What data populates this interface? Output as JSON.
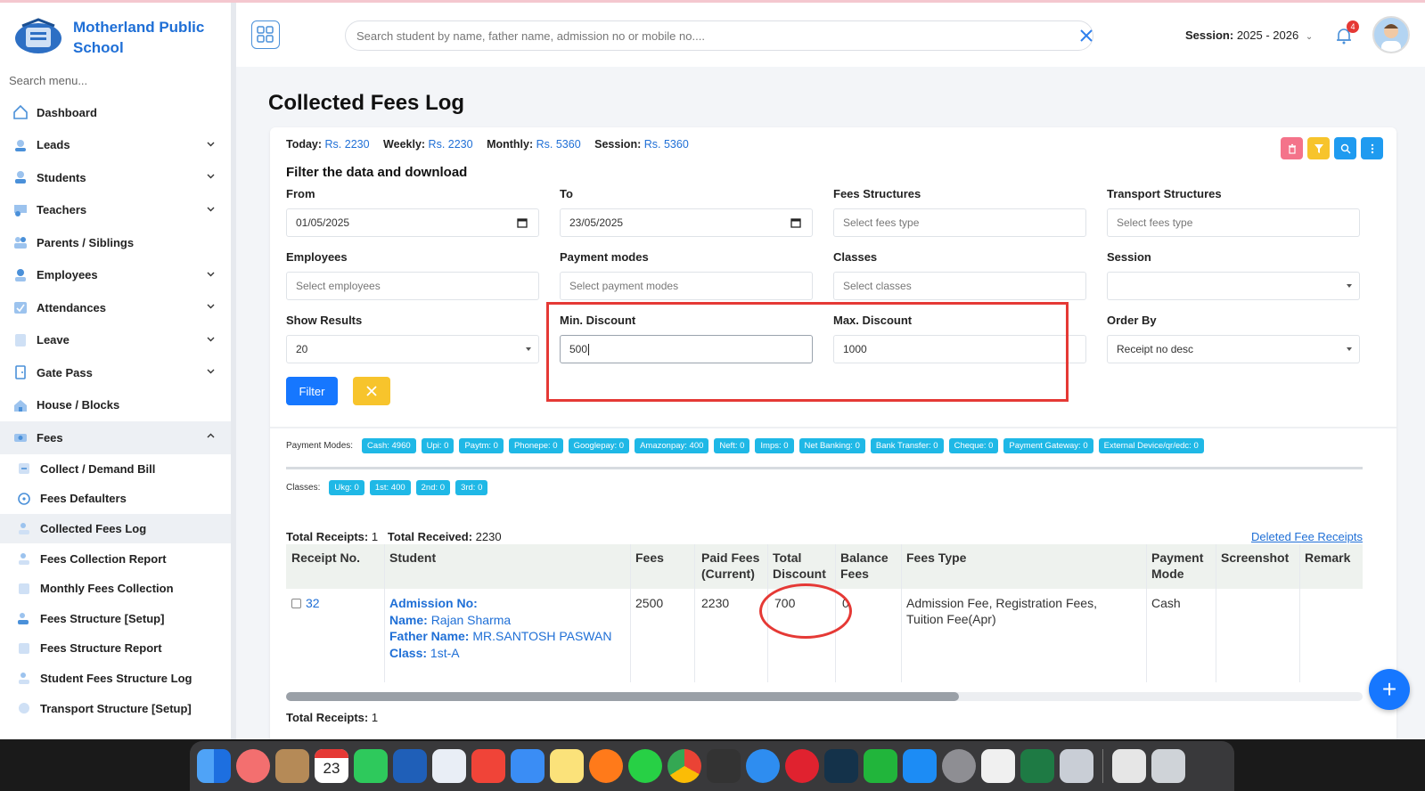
{
  "school": {
    "name": "Motherland Public School"
  },
  "sidebar": {
    "search_placeholder": "Search menu...",
    "items": [
      {
        "label": "Dashboard",
        "icon": "home-icon",
        "chevron": false
      },
      {
        "label": "Leads",
        "icon": "leads-icon",
        "chevron": true
      },
      {
        "label": "Students",
        "icon": "students-icon",
        "chevron": true
      },
      {
        "label": "Teachers",
        "icon": "teachers-icon",
        "chevron": true
      },
      {
        "label": "Parents / Siblings",
        "icon": "parents-icon",
        "chevron": false
      },
      {
        "label": "Employees",
        "icon": "employees-icon",
        "chevron": true
      },
      {
        "label": "Attendances",
        "icon": "attendance-icon",
        "chevron": true
      },
      {
        "label": "Leave",
        "icon": "leave-icon",
        "chevron": true
      },
      {
        "label": "Gate Pass",
        "icon": "gate-pass-icon",
        "chevron": true
      },
      {
        "label": "House / Blocks",
        "icon": "house-icon",
        "chevron": false
      },
      {
        "label": "Fees",
        "icon": "fees-icon",
        "chevron": true,
        "expanded": true
      }
    ],
    "fees_sub": [
      "Collect / Demand Bill",
      "Fees Defaulters",
      "Collected Fees Log",
      "Fees Collection Report",
      "Monthly Fees Collection",
      "Fees Structure [Setup]",
      "Fees Structure Report",
      "Student Fees Structure Log",
      "Transport Structure [Setup]"
    ],
    "active_sub": "Collected Fees Log"
  },
  "header": {
    "search_placeholder": "Search student by name, father name, admission no or mobile no....",
    "session_label": "Session:",
    "session_value": "2025 - 2026",
    "notifications": "4"
  },
  "page": {
    "title": "Collected Fees Log",
    "summary": {
      "today_label": "Today:",
      "today": "Rs. 2230",
      "weekly_label": "Weekly:",
      "weekly": "Rs. 2230",
      "monthly_label": "Monthly:",
      "monthly": "Rs. 5360",
      "session_label": "Session:",
      "session": "Rs. 5360"
    },
    "filter_heading": "Filter the data and download",
    "filters": {
      "from_label": "From",
      "from_value": "01/05/2025",
      "to_label": "To",
      "to_value": "23/05/2025",
      "fees_structures_label": "Fees Structures",
      "fees_structures_placeholder": "Select fees type",
      "transport_structures_label": "Transport Structures",
      "transport_structures_placeholder": "Select fees type",
      "employees_label": "Employees",
      "employees_placeholder": "Select employees",
      "payment_modes_label": "Payment modes",
      "payment_modes_placeholder": "Select payment modes",
      "classes_label": "Classes",
      "classes_placeholder": "Select classes",
      "session_label": "Session",
      "session_value": "",
      "show_results_label": "Show Results",
      "show_results_value": "20",
      "min_discount_label": "Min. Discount",
      "min_discount_value": "500",
      "max_discount_label": "Max. Discount",
      "max_discount_value": "1000",
      "order_by_label": "Order By",
      "order_by_value": "Receipt no desc",
      "filter_button": "Filter"
    },
    "payment_modes_label": "Payment Modes:",
    "payment_modes": [
      "Cash: 4960",
      "Upi: 0",
      "Paytm: 0",
      "Phonepe: 0",
      "Googlepay: 0",
      "Amazonpay: 400",
      "Neft: 0",
      "Imps: 0",
      "Net Banking: 0",
      "Bank Transfer: 0",
      "Cheque: 0",
      "Payment Gateway: 0",
      "External Device/qr/edc: 0"
    ],
    "classes_label": "Classes:",
    "classes": [
      "Ukg: 0",
      "1st: 400",
      "2nd: 0",
      "3rd: 0"
    ],
    "total_receipts_label": "Total Receipts:",
    "total_receipts": "1",
    "total_received_label": "Total Received:",
    "total_received": "2230",
    "deleted_link": "Deleted Fee Receipts",
    "table": {
      "headers": {
        "receipt": "Receipt No.",
        "student": "Student",
        "fees": "Fees",
        "paid_1": "Paid Fees",
        "paid_2": "(Current)",
        "discount_1": "Total",
        "discount_2": "Discount",
        "balance_1": "Balance",
        "balance_2": "Fees",
        "fees_type": "Fees Type",
        "mode_1": "Payment",
        "mode_2": "Mode",
        "screenshot": "Screenshot",
        "remark": "Remark"
      },
      "rows": [
        {
          "receipt": "32",
          "admission_label": "Admission No:",
          "admission": "",
          "name_label": "Name:",
          "name": "Rajan Sharma",
          "father_label": "Father Name:",
          "father": "MR.SANTOSH PASWAN",
          "class_label": "Class:",
          "class": "1st-A",
          "fees": "2500",
          "paid": "2230",
          "discount": "700",
          "balance": "0",
          "fees_type_1": "Admission Fee, Registration Fees,",
          "fees_type_2": "Tuition Fee(Apr)",
          "mode": "Cash"
        }
      ]
    },
    "footer_total_label": "Total Receipts:",
    "footer_total": "1"
  },
  "dock": {
    "calendar_day": "23",
    "calendar_month": "MAY"
  },
  "colors": {
    "accent": "#1677ff",
    "link": "#1f6fd6",
    "highlight": "#e53935",
    "tag": "#1fb8e6"
  }
}
